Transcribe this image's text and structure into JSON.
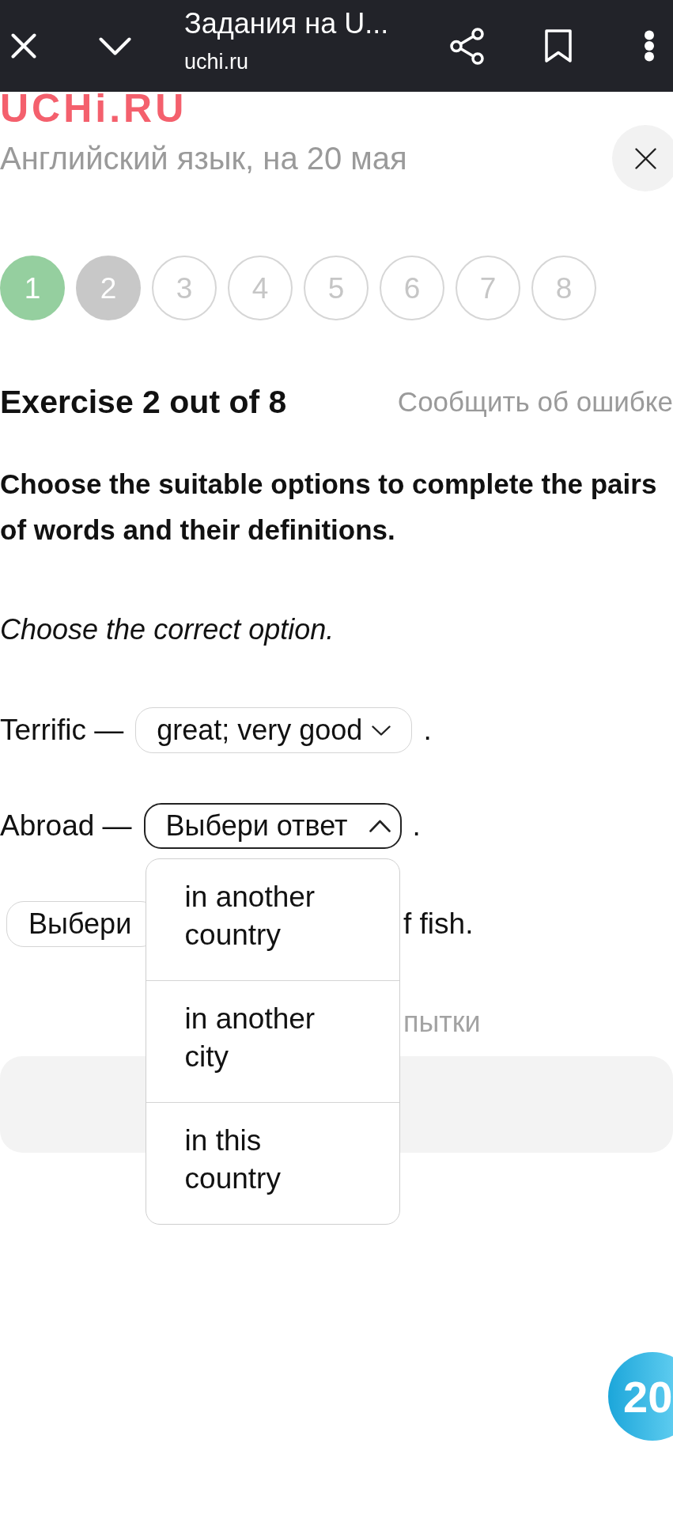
{
  "browser_bar": {
    "title": "Задания на U...",
    "url": "uchi.ru"
  },
  "header": {
    "logo": "UCHi.RU",
    "subtitle": "Английский язык, на 20 мая"
  },
  "steps": [
    {
      "label": "1",
      "done": true,
      "selected": false
    },
    {
      "label": "2",
      "done": false,
      "selected": true
    },
    {
      "label": "3",
      "done": false,
      "selected": false
    },
    {
      "label": "4",
      "done": false,
      "selected": false
    },
    {
      "label": "5",
      "done": false,
      "selected": false
    },
    {
      "label": "6",
      "done": false,
      "selected": false
    },
    {
      "label": "7",
      "done": false,
      "selected": false
    },
    {
      "label": "8",
      "done": false,
      "selected": false
    }
  ],
  "exercise": {
    "title": "Exercise 2 out of 8",
    "report_link": "Сообщить об ошибке",
    "instruction": "Choose the suitable options to complete the pairs of words and their definitions.",
    "hint": "Choose the correct option."
  },
  "sentences": [
    {
      "kind": "select",
      "before": "Terrific —",
      "value": "great; very good",
      "after": ".",
      "open": false
    },
    {
      "kind": "select",
      "before": "Abroad —",
      "placeholder": "Выбери ответ",
      "after": ".",
      "open": true,
      "options": [
        "in another country",
        "in another city",
        "in this country"
      ]
    },
    {
      "kind": "covered",
      "placeholder": "Выбери",
      "after": "f fish.",
      "open": false
    }
  ],
  "attempts_note": "пытки",
  "score_badge": "20"
}
